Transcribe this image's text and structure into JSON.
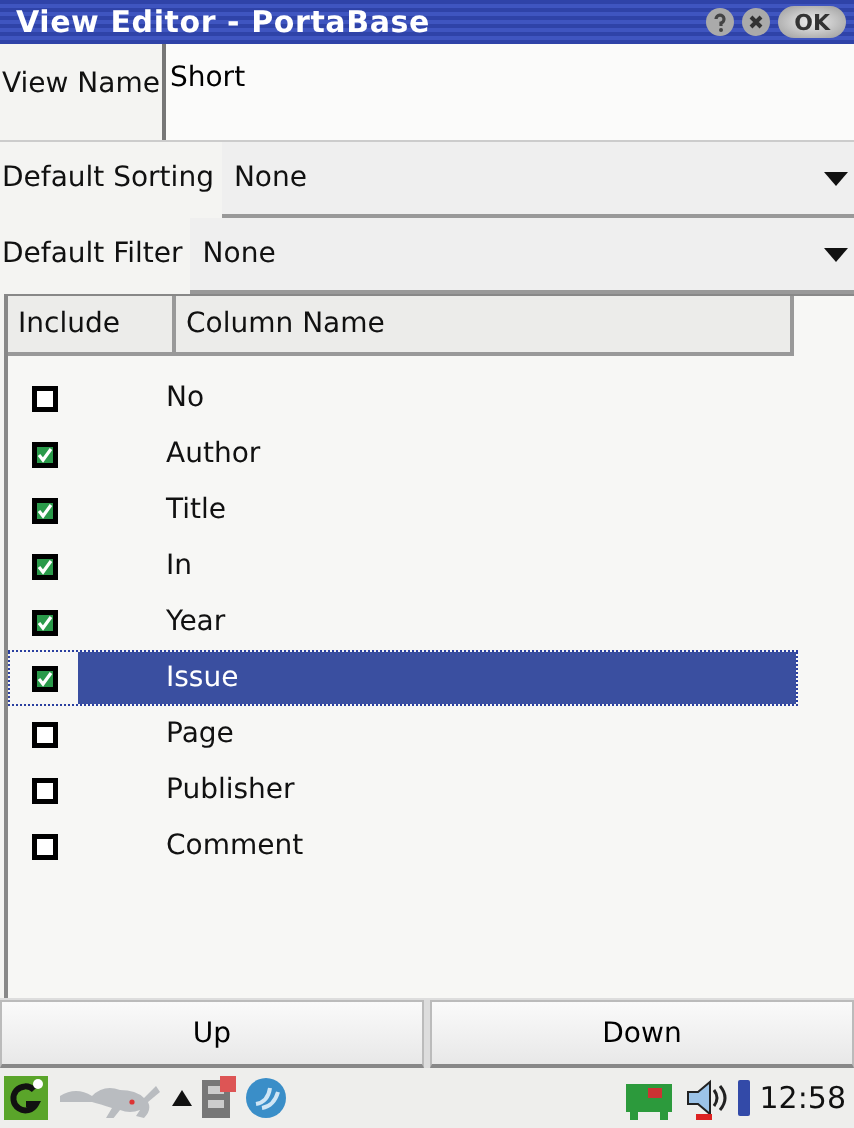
{
  "window": {
    "title": "View Editor - PortaBase",
    "ok_button": "OK"
  },
  "view_name": {
    "label": "View Name",
    "value": "Short"
  },
  "selects": [
    {
      "label": "Default Sorting",
      "value": "None"
    },
    {
      "label": "Default Filter",
      "value": "None"
    }
  ],
  "table": {
    "columns": [
      "Include",
      "Column Name"
    ],
    "rows": [
      {
        "name": "No",
        "checked": false,
        "selected": false
      },
      {
        "name": "Author",
        "checked": true,
        "selected": false
      },
      {
        "name": "Title",
        "checked": true,
        "selected": false
      },
      {
        "name": "In",
        "checked": true,
        "selected": false
      },
      {
        "name": "Year",
        "checked": true,
        "selected": false
      },
      {
        "name": "Issue",
        "checked": true,
        "selected": true
      },
      {
        "name": "Page",
        "checked": false,
        "selected": false
      },
      {
        "name": "Publisher",
        "checked": false,
        "selected": false
      },
      {
        "name": "Comment",
        "checked": false,
        "selected": false
      }
    ]
  },
  "buttons": [
    "Up",
    "Down"
  ],
  "taskbar": {
    "clock": "12:58"
  }
}
